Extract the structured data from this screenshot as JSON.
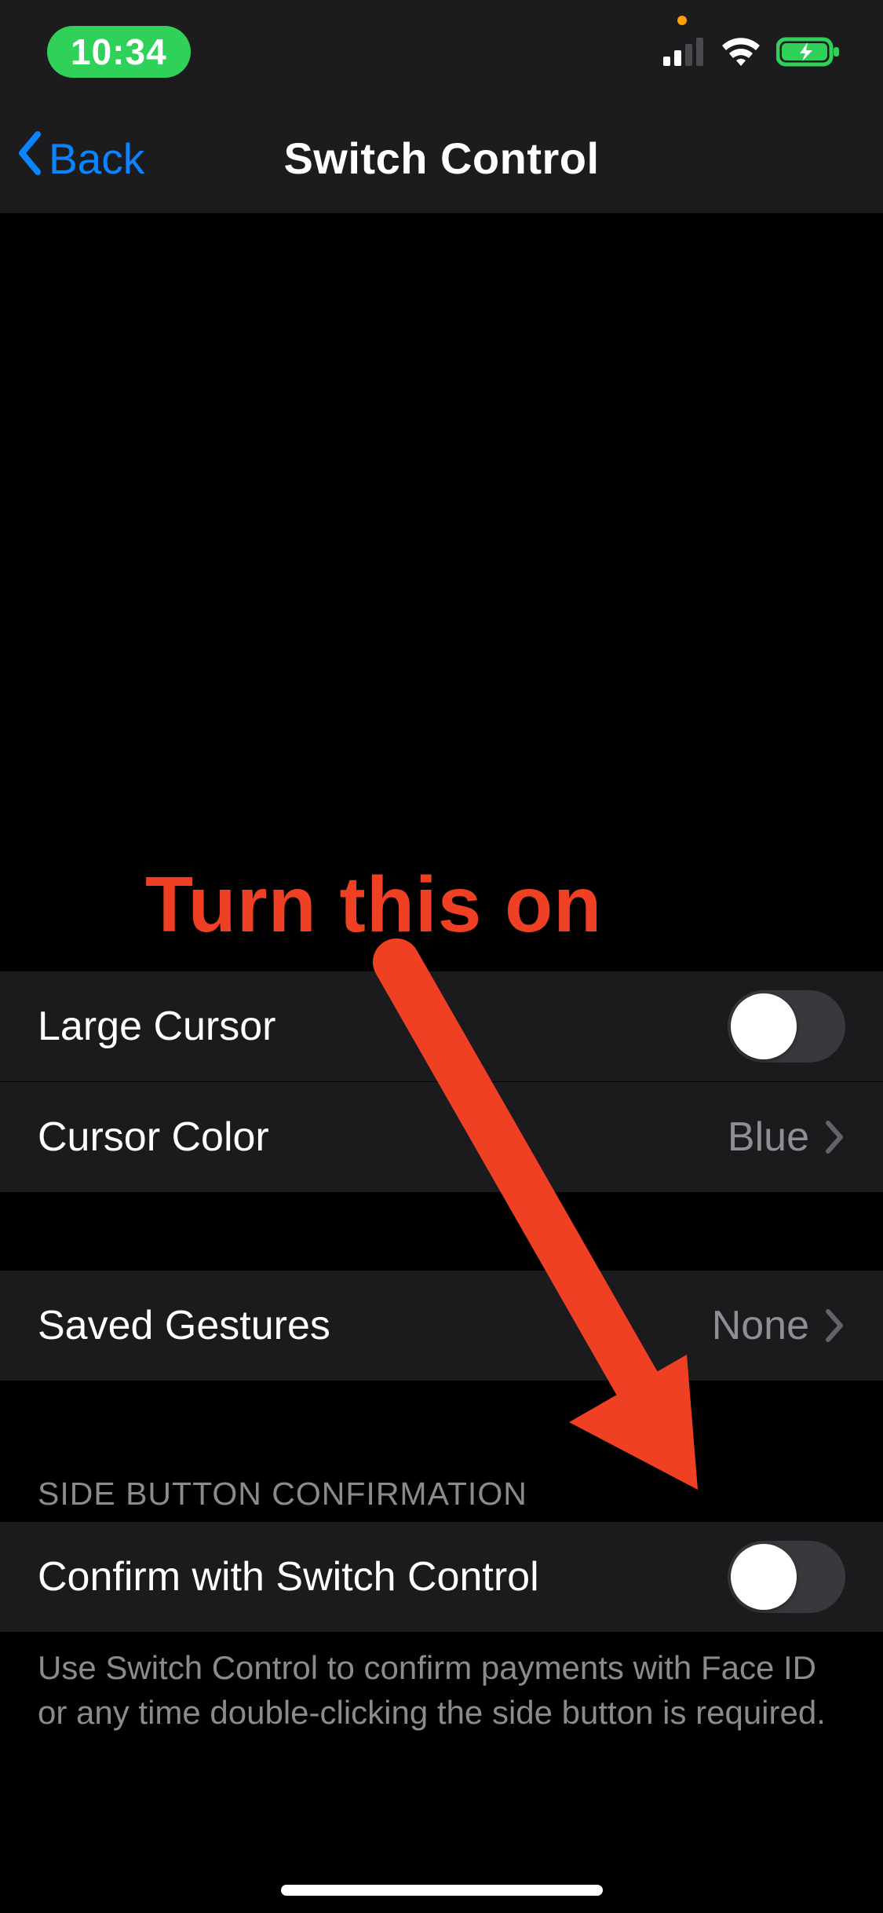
{
  "status": {
    "time": "10:34"
  },
  "nav": {
    "back_label": "Back",
    "title": "Switch Control"
  },
  "rows": {
    "large_cursor": {
      "label": "Large Cursor",
      "on": false
    },
    "cursor_color": {
      "label": "Cursor Color",
      "value": "Blue"
    },
    "saved_gestures": {
      "label": "Saved Gestures",
      "value": "None"
    }
  },
  "side_button_section": {
    "header": "SIDE BUTTON CONFIRMATION",
    "toggle_label": "Confirm with Switch Control",
    "toggle_on": false,
    "footer": "Use Switch Control to confirm payments with Face ID or any time double-clicking the side button is required."
  },
  "annotation": {
    "text": "Turn this on"
  },
  "colors": {
    "accent_blue": "#0a84ff",
    "annotation_red": "#ef4023",
    "time_pill_green": "#30d158"
  }
}
